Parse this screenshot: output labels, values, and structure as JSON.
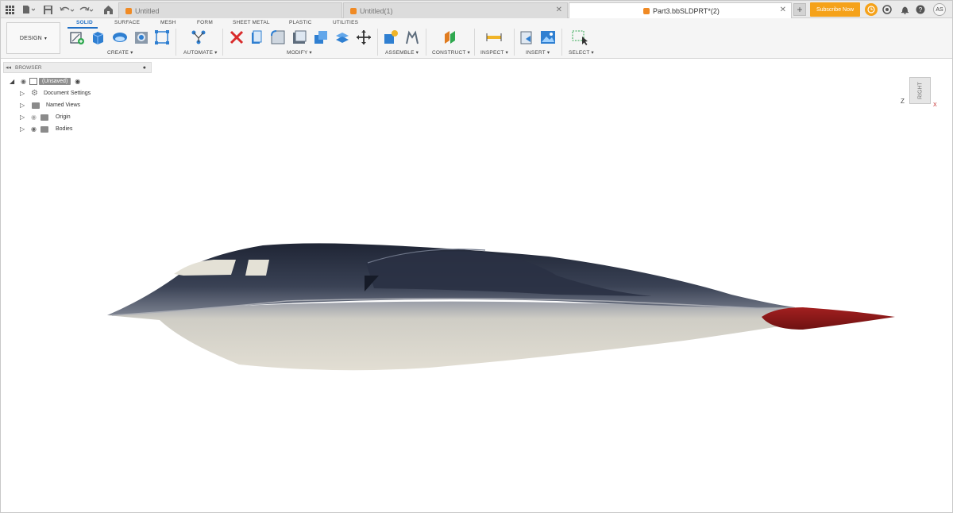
{
  "tabs": [
    {
      "label": "Untitled",
      "active": false
    },
    {
      "label": "Untitled(1)",
      "active": false
    },
    {
      "label": "Part3.bbSLDPRT*(2)",
      "active": true
    }
  ],
  "subscribe_label": "Subscribe Now",
  "avatar_initials": "AS",
  "design_label": "DESIGN",
  "workspace_tabs": [
    "SOLID",
    "SURFACE",
    "MESH",
    "FORM",
    "SHEET METAL",
    "PLASTIC",
    "UTILITIES"
  ],
  "groups": [
    "CREATE",
    "AUTOMATE",
    "MODIFY",
    "ASSEMBLE",
    "CONSTRUCT",
    "INSPECT",
    "INSERT",
    "SELECT"
  ],
  "browser": {
    "title": "BROWSER",
    "root": "(Unsaved)",
    "items": [
      "Document Settings",
      "Named Views",
      "Origin",
      "Bodies"
    ]
  },
  "viewcube": {
    "face": "RIGHT",
    "axis_z": "Z",
    "axis_x": "X"
  },
  "colors": {
    "accent": "#1f6fc5",
    "subscribe": "#f5a21a",
    "body_dark": "#2b3242",
    "body_light": "#d9d7cf",
    "tail_red": "#9b1b1b"
  },
  "icons": [
    "grid-icon",
    "file-icon",
    "save-icon",
    "undo-icon",
    "redo-icon",
    "home-icon",
    "help-icon",
    "bell-icon",
    "clock-icon"
  ]
}
